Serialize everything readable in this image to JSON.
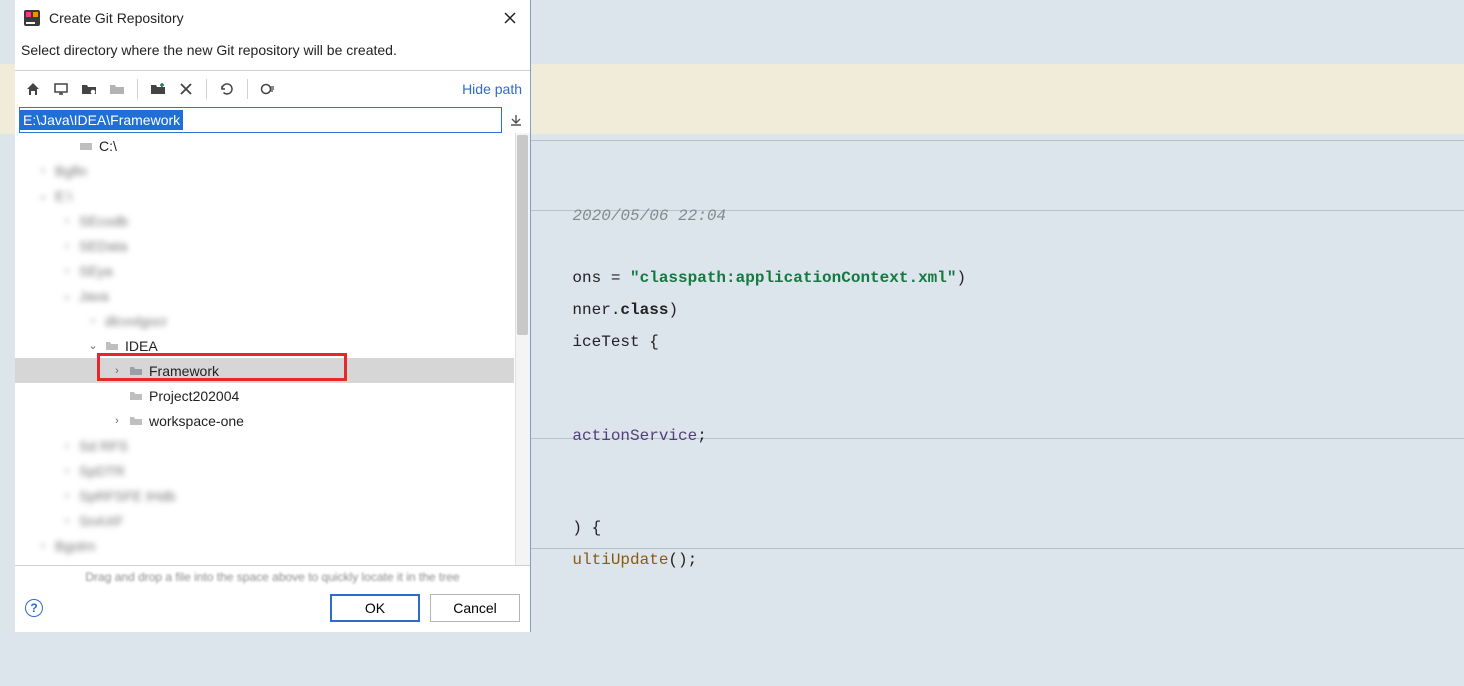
{
  "dialog": {
    "title": "Create Git Repository",
    "instruction": "Select directory where the new Git repository will be created.",
    "hide_path": "Hide path",
    "path_value": "E:\\Java\\IDEA\\Framework",
    "hint": "Drag and drop a file into the space above to quickly locate it in the tree",
    "buttons": {
      "ok": "OK",
      "cancel": "Cancel"
    },
    "tree": {
      "c_drive": "C:\\",
      "idea": "IDEA",
      "framework": "Framework",
      "project": "Project202004",
      "workspace": "workspace-one"
    }
  },
  "code": {
    "date_comment": "2020/05/06 22:04",
    "line_ctx1_a": "ons = ",
    "line_ctx1_b": "\"classpath:applicationContext.xml\"",
    "line_ctx1_c": ")",
    "line_ctx2_a": "nner.",
    "line_ctx2_b": "class",
    "line_ctx2_c": ")",
    "line_ctx3": "iceTest {",
    "line_field_a": "actionService",
    "line_field_b": ";",
    "line_m1": ") {",
    "line_m2_a": "ultiUpdate",
    "line_m2_b": "();"
  }
}
